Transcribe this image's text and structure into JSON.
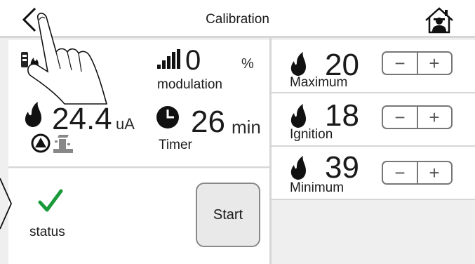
{
  "header": {
    "title": "Calibration"
  },
  "flame_current": {
    "value": "24.4",
    "unit": "uA"
  },
  "modulation": {
    "value": "0",
    "unit": "%",
    "label": "modulation"
  },
  "timer": {
    "value": "26",
    "unit": "min",
    "label": "Timer"
  },
  "status": {
    "label": "status"
  },
  "start_label": "Start",
  "settings": [
    {
      "value": "20",
      "label": "Maximum",
      "minus": "−",
      "plus": "+"
    },
    {
      "value": "18",
      "label": "Ignition",
      "minus": "−",
      "plus": "+"
    },
    {
      "value": "39",
      "label": "Minimum",
      "minus": "−",
      "plus": "+"
    }
  ],
  "colors": {
    "check": "#1a9a3a",
    "divider": "#d6d6d6"
  }
}
